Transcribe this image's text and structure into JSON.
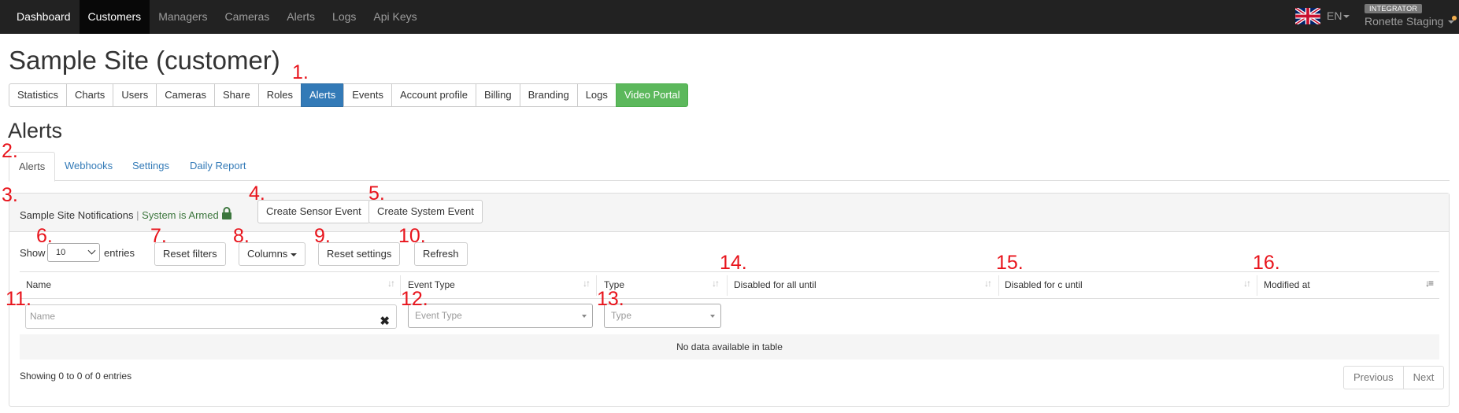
{
  "navbar": {
    "items": [
      "Dashboard",
      "Customers",
      "Managers",
      "Cameras",
      "Alerts",
      "Logs",
      "Api Keys"
    ],
    "language": "EN",
    "role_badge": "INTEGRATOR",
    "user_name": "Ronette Staging"
  },
  "page": {
    "title": "Sample Site (customer)",
    "section_title": "Alerts"
  },
  "button_group": [
    "Statistics",
    "Charts",
    "Users",
    "Cameras",
    "Share",
    "Roles",
    "Alerts",
    "Events",
    "Account profile",
    "Billing",
    "Branding",
    "Logs",
    "Video Portal"
  ],
  "tabs": [
    "Alerts",
    "Webhooks",
    "Settings",
    "Daily Report"
  ],
  "panel": {
    "title": "Sample Site Notifications",
    "separator": "|",
    "status": "System is Armed",
    "create_sensor_label": "Create Sensor Event",
    "create_system_label": "Create System Event"
  },
  "controls": {
    "show_label": "Show",
    "entries_value": "10",
    "entries_label": "entries",
    "reset_filters": "Reset filters",
    "columns": "Columns",
    "reset_settings": "Reset settings",
    "refresh": "Refresh"
  },
  "table": {
    "headers": [
      "Name",
      "Event Type",
      "Type",
      "Disabled for all until",
      "Disabled for c until",
      "Modified at"
    ],
    "filters": {
      "name_placeholder": "Name",
      "event_type_placeholder": "Event Type",
      "type_placeholder": "Type"
    },
    "empty_text": "No data available in table",
    "info_text": "Showing 0 to 0 of 0 entries",
    "pagination": [
      "Previous",
      "Next"
    ]
  },
  "annotations": [
    "1.",
    "2.",
    "3.",
    "4.",
    "5.",
    "6.",
    "7.",
    "8.",
    "9.",
    "10.",
    "11.",
    "12.",
    "13.",
    "14.",
    "15.",
    "16."
  ],
  "colors": {
    "navbar": "#222222",
    "primary": "#337ab7",
    "success": "#5cb85c",
    "armed": "#3c763d",
    "annotation": "#e8141c"
  }
}
